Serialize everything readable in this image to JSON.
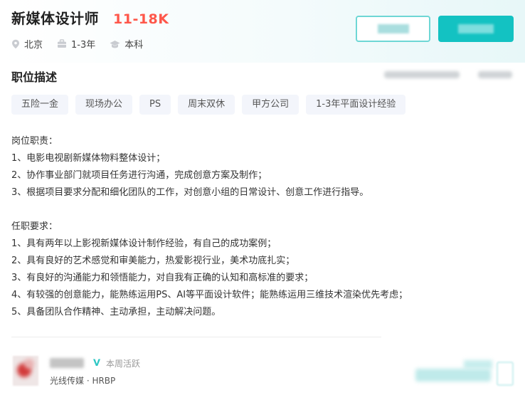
{
  "job": {
    "title": "新媒体设计师",
    "salary": "11-18K",
    "location": "北京",
    "experience": "1-3年",
    "education": "本科",
    "icons": {
      "location": "location-pin-icon",
      "experience": "briefcase-icon",
      "education": "graduation-cap-icon"
    }
  },
  "colors": {
    "accent": "#13c2c2",
    "salary": "#fe574a",
    "tag_bg": "#f3f5fb"
  },
  "section": {
    "title": "职位描述"
  },
  "tags": [
    "五险一金",
    "现场办公",
    "PS",
    "周末双休",
    "甲方公司",
    "1-3年平面设计经验"
  ],
  "description": {
    "duties_title": "岗位职责：",
    "duties": [
      "1、电影电视剧新媒体物料整体设计；",
      "2、协作事业部门就项目任务进行沟通，完成创意方案及制作；",
      "3、根据项目要求分配和细化团队的工作，对创意小组的日常设计、创意工作进行指导。"
    ],
    "requirements_title": "任职要求：",
    "requirements": [
      "1、具有两年以上影视新媒体设计制作经验，有自己的成功案例；",
      "2、具有良好的艺术感觉和审美能力，热爱影视行业，美术功底扎实；",
      "3、有良好的沟通能力和领悟能力，对自我有正确的认知和高标准的要求；",
      "4、有较强的创意能力，能熟练运用PS、AI等平面设计软件；能熟练运用三维技术渲染优先考虑；",
      "5、具备团队合作精神、主动承担，主动解决问题。"
    ]
  },
  "recruiter": {
    "status": "本周活跃",
    "company": "光线传媒 · HRBP"
  }
}
